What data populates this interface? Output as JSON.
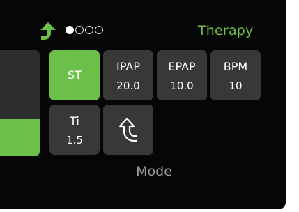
{
  "header": {
    "title": "Therapy",
    "page_indicator": {
      "total": 4,
      "current": 1
    },
    "back_icon": "up-arrow-icon"
  },
  "colors": {
    "accent": "#6cc04a",
    "tile": "#383838",
    "background": "#060606"
  },
  "tiles": [
    {
      "label": "ST",
      "value": "",
      "active": true
    },
    {
      "label": "IPAP",
      "value": "20.0",
      "active": false
    },
    {
      "label": "EPAP",
      "value": "10.0",
      "active": false
    },
    {
      "label": "BPM",
      "value": "10",
      "active": false
    },
    {
      "label": "Ti",
      "value": "1.5",
      "active": false
    },
    {
      "label": "",
      "value": "",
      "icon": "mode-arrow-icon",
      "active": false
    }
  ],
  "footer": {
    "label": "Mode"
  }
}
